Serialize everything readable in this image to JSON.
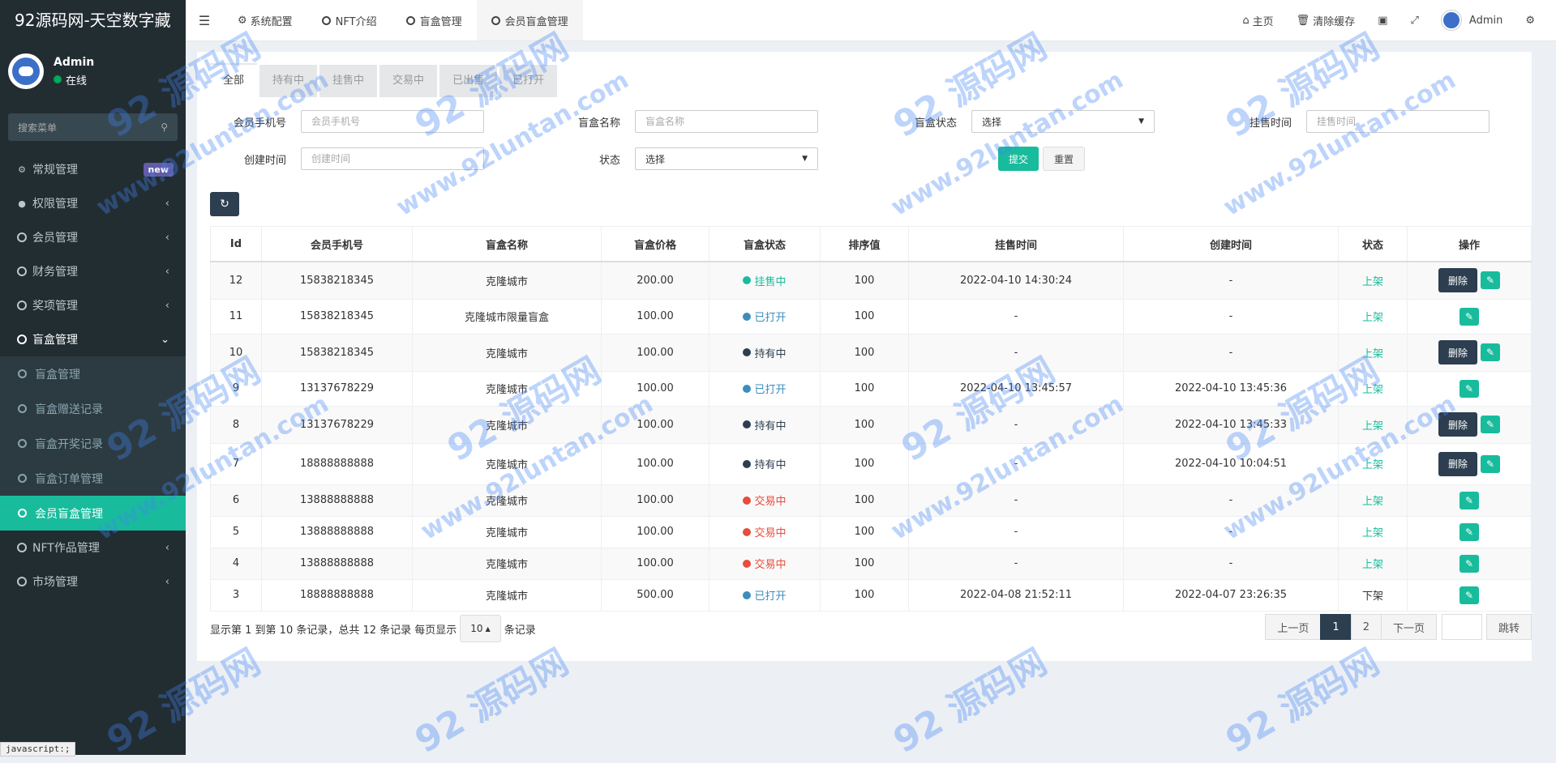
{
  "app": {
    "title": "92源码网-天空数字藏"
  },
  "user": {
    "name": "Admin",
    "status": "在线"
  },
  "sidebar": {
    "search_placeholder": "搜索菜单",
    "items": [
      {
        "label": "常规管理",
        "badge": "new"
      },
      {
        "label": "权限管理"
      },
      {
        "label": "会员管理"
      },
      {
        "label": "财务管理"
      },
      {
        "label": "奖项管理"
      },
      {
        "label": "盲盒管理"
      },
      {
        "label": "NFT作品管理"
      },
      {
        "label": "市场管理"
      }
    ],
    "submenu": [
      {
        "label": "盲盒管理"
      },
      {
        "label": "盲盒赠送记录"
      },
      {
        "label": "盲盒开奖记录"
      },
      {
        "label": "盲盒订单管理"
      },
      {
        "label": "会员盲盒管理"
      }
    ]
  },
  "topbar": {
    "tabs": [
      "系统配置",
      "NFT介绍",
      "盲盒管理",
      "会员盲盒管理"
    ],
    "home": "主页",
    "clear_cache": "清除缓存",
    "admin": "Admin"
  },
  "status_tabs": [
    "全部",
    "持有中",
    "挂售中",
    "交易中",
    "已出售",
    "已打开"
  ],
  "filters": {
    "phone_label": "会员手机号",
    "phone_placeholder": "会员手机号",
    "box_name_label": "盲盒名称",
    "box_name_placeholder": "盲盒名称",
    "box_status_label": "盲盒状态",
    "box_status_value": "选择",
    "sale_time_label": "挂售时间",
    "sale_time_placeholder": "挂售时间",
    "create_time_label": "创建时间",
    "create_time_placeholder": "创建时间",
    "status_label": "状态",
    "status_value": "选择",
    "submit": "提交",
    "reset": "重置"
  },
  "table": {
    "headers": [
      "Id",
      "会员手机号",
      "盲盒名称",
      "盲盒价格",
      "盲盒状态",
      "排序值",
      "挂售时间",
      "创建时间",
      "状态",
      "操作"
    ],
    "delete_label": "删除",
    "rows": [
      {
        "id": "12",
        "phone": "15838218345",
        "name": "克隆城市",
        "price": "200.00",
        "box_status": "挂售中",
        "status_color": "#18bc9c",
        "sort": "100",
        "sale_time": "2022-04-10 14:30:24",
        "create_time": "-",
        "shelf": "上架",
        "del": true
      },
      {
        "id": "11",
        "phone": "15838218345",
        "name": "克隆城市限量盲盒",
        "price": "100.00",
        "box_status": "已打开",
        "status_color": "#3c8dbc",
        "sort": "100",
        "sale_time": "-",
        "create_time": "-",
        "shelf": "上架",
        "del": false
      },
      {
        "id": "10",
        "phone": "15838218345",
        "name": "克隆城市",
        "price": "100.00",
        "box_status": "持有中",
        "status_color": "#2c3e50",
        "sort": "100",
        "sale_time": "-",
        "create_time": "-",
        "shelf": "上架",
        "del": true
      },
      {
        "id": "9",
        "phone": "13137678229",
        "name": "克隆城市",
        "price": "100.00",
        "box_status": "已打开",
        "status_color": "#3c8dbc",
        "sort": "100",
        "sale_time": "2022-04-10 13:45:57",
        "create_time": "2022-04-10 13:45:36",
        "shelf": "上架",
        "del": false
      },
      {
        "id": "8",
        "phone": "13137678229",
        "name": "克隆城市",
        "price": "100.00",
        "box_status": "持有中",
        "status_color": "#2c3e50",
        "sort": "100",
        "sale_time": "-",
        "create_time": "2022-04-10 13:45:33",
        "shelf": "上架",
        "del": true
      },
      {
        "id": "7",
        "phone": "18888888888",
        "name": "克隆城市",
        "price": "100.00",
        "box_status": "持有中",
        "status_color": "#2c3e50",
        "sort": "100",
        "sale_time": "-",
        "create_time": "2022-04-10 10:04:51",
        "shelf": "上架",
        "del": true
      },
      {
        "id": "6",
        "phone": "13888888888",
        "name": "克隆城市",
        "price": "100.00",
        "box_status": "交易中",
        "status_color": "#e74c3c",
        "sort": "100",
        "sale_time": "-",
        "create_time": "-",
        "shelf": "上架",
        "del": false
      },
      {
        "id": "5",
        "phone": "13888888888",
        "name": "克隆城市",
        "price": "100.00",
        "box_status": "交易中",
        "status_color": "#e74c3c",
        "sort": "100",
        "sale_time": "-",
        "create_time": "-",
        "shelf": "上架",
        "del": false
      },
      {
        "id": "4",
        "phone": "13888888888",
        "name": "克隆城市",
        "price": "100.00",
        "box_status": "交易中",
        "status_color": "#e74c3c",
        "sort": "100",
        "sale_time": "-",
        "create_time": "-",
        "shelf": "上架",
        "del": false
      },
      {
        "id": "3",
        "phone": "18888888888",
        "name": "克隆城市",
        "price": "500.00",
        "box_status": "已打开",
        "status_color": "#3c8dbc",
        "sort": "100",
        "sale_time": "2022-04-08 21:52:11",
        "create_time": "2022-04-07 23:26:35",
        "shelf": "下架",
        "del": false
      }
    ]
  },
  "footer": {
    "info_prefix": "显示第 1 到第 10 条记录，总共 12 条记录 每页显示",
    "page_size": "10",
    "info_suffix": "条记录"
  },
  "pager": {
    "prev": "上一页",
    "pages": [
      "1",
      "2"
    ],
    "next": "下一页",
    "jump": "跳转"
  },
  "browser_status": "javascript:;",
  "watermark": {
    "logo": "92 源码网",
    "url": "www.92luntan.com"
  },
  "colors": {
    "accent": "#18bc9c",
    "sidebar": "#222d32",
    "dark_button": "#2c3e50"
  }
}
